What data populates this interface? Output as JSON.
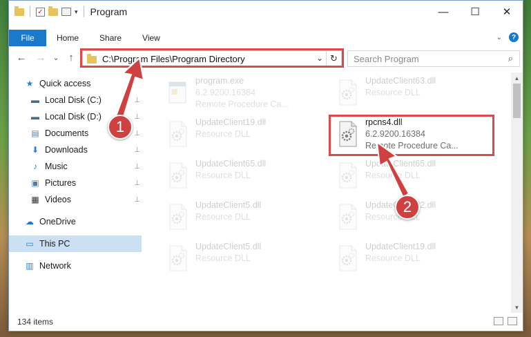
{
  "window": {
    "title": "Program",
    "minimize_glyph": "—",
    "maximize_glyph": "☐",
    "close_glyph": "✕"
  },
  "quick_access_toolbar": {
    "check_glyph": "✓",
    "dropdown_glyph": "▾"
  },
  "ribbon": {
    "file": "File",
    "tabs": [
      "Home",
      "Share",
      "View"
    ],
    "collapse_glyph": "⌄",
    "help_glyph": "?"
  },
  "navigation": {
    "back_glyph": "←",
    "forward_glyph": "→",
    "recent_glyph": "⌄",
    "up_glyph": "↑",
    "address": "C:\\Program Files\\Program Directory",
    "address_dropdown_glyph": "⌄",
    "refresh_glyph": "↻",
    "search_placeholder": "Search Program",
    "search_glyph": "⌕"
  },
  "sidebar": {
    "items": [
      {
        "label": "Quick access",
        "icon": "star-icon",
        "glyph": "★",
        "color": "#2b7fd4",
        "pinned": false
      },
      {
        "label": "Local Disk (C:)",
        "icon": "drive-icon",
        "glyph": "▬",
        "color": "#4a6a8a",
        "pinned": true
      },
      {
        "label": "Local Disk (D:)",
        "icon": "drive-icon",
        "glyph": "▬",
        "color": "#4a6a8a",
        "pinned": true
      },
      {
        "label": "Documents",
        "icon": "documents-icon",
        "glyph": "▤",
        "color": "#5a7fa8",
        "pinned": true
      },
      {
        "label": "Downloads",
        "icon": "download-icon",
        "glyph": "⬇",
        "color": "#2b7fd4",
        "pinned": true
      },
      {
        "label": "Music",
        "icon": "music-icon",
        "glyph": "♪",
        "color": "#2b7fd4",
        "pinned": true
      },
      {
        "label": "Pictures",
        "icon": "pictures-icon",
        "glyph": "▣",
        "color": "#4a7aa8",
        "pinned": true
      },
      {
        "label": "Videos",
        "icon": "video-icon",
        "glyph": "▦",
        "color": "#333333",
        "pinned": true
      },
      {
        "label": "OneDrive",
        "icon": "cloud-icon",
        "glyph": "☁",
        "color": "#1979ca",
        "pinned": false
      },
      {
        "label": "This PC",
        "icon": "computer-icon",
        "glyph": "▭",
        "color": "#2b7fd4",
        "pinned": false
      },
      {
        "label": "Network",
        "icon": "network-icon",
        "glyph": "▥",
        "color": "#2b7fd4",
        "pinned": false
      }
    ],
    "pin_glyph": "📌"
  },
  "files": [
    {
      "name": "program.exe",
      "line2": "6.2.9200.16384",
      "line3": "Remote Procedure Ca...",
      "faded": true,
      "kind": "exe"
    },
    {
      "name": "UpdateClient63.dll",
      "line2": "Resource DLL",
      "line3": "",
      "faded": true,
      "kind": "dll"
    },
    {
      "name": "UpdateClient19.dll",
      "line2": "Resource DLL",
      "line3": "",
      "faded": true,
      "kind": "dll"
    },
    {
      "name": "rpcns4.dll",
      "line2": "6.2.9200.16384",
      "line3": "Remote Procedure Ca...",
      "faded": false,
      "kind": "dll-gear"
    },
    {
      "name": "UpdateClient65.dll",
      "line2": "Resource DLL",
      "line3": "",
      "faded": true,
      "kind": "dll"
    },
    {
      "name": "UpdateClient65.dll",
      "line2": "Resource DLL",
      "line3": "",
      "faded": true,
      "kind": "dll"
    },
    {
      "name": "UpdateClient5.dll",
      "line2": "Resource DLL",
      "line3": "",
      "faded": true,
      "kind": "dll"
    },
    {
      "name": "UpdateClient52.dll",
      "line2": "Resource DLL",
      "line3": "",
      "faded": true,
      "kind": "dll"
    },
    {
      "name": "UpdateClient5.dll",
      "line2": "Resource DLL",
      "line3": "",
      "faded": true,
      "kind": "dll"
    },
    {
      "name": "UpdateClient19.dll",
      "line2": "Resource DLL",
      "line3": "",
      "faded": true,
      "kind": "dll"
    }
  ],
  "scrollbar": {
    "up_glyph": "▲",
    "down_glyph": "▼"
  },
  "status": {
    "item_count": "134 items"
  },
  "annotations": {
    "callout_1": "1",
    "callout_2": "2",
    "color": "#d94b4b"
  }
}
